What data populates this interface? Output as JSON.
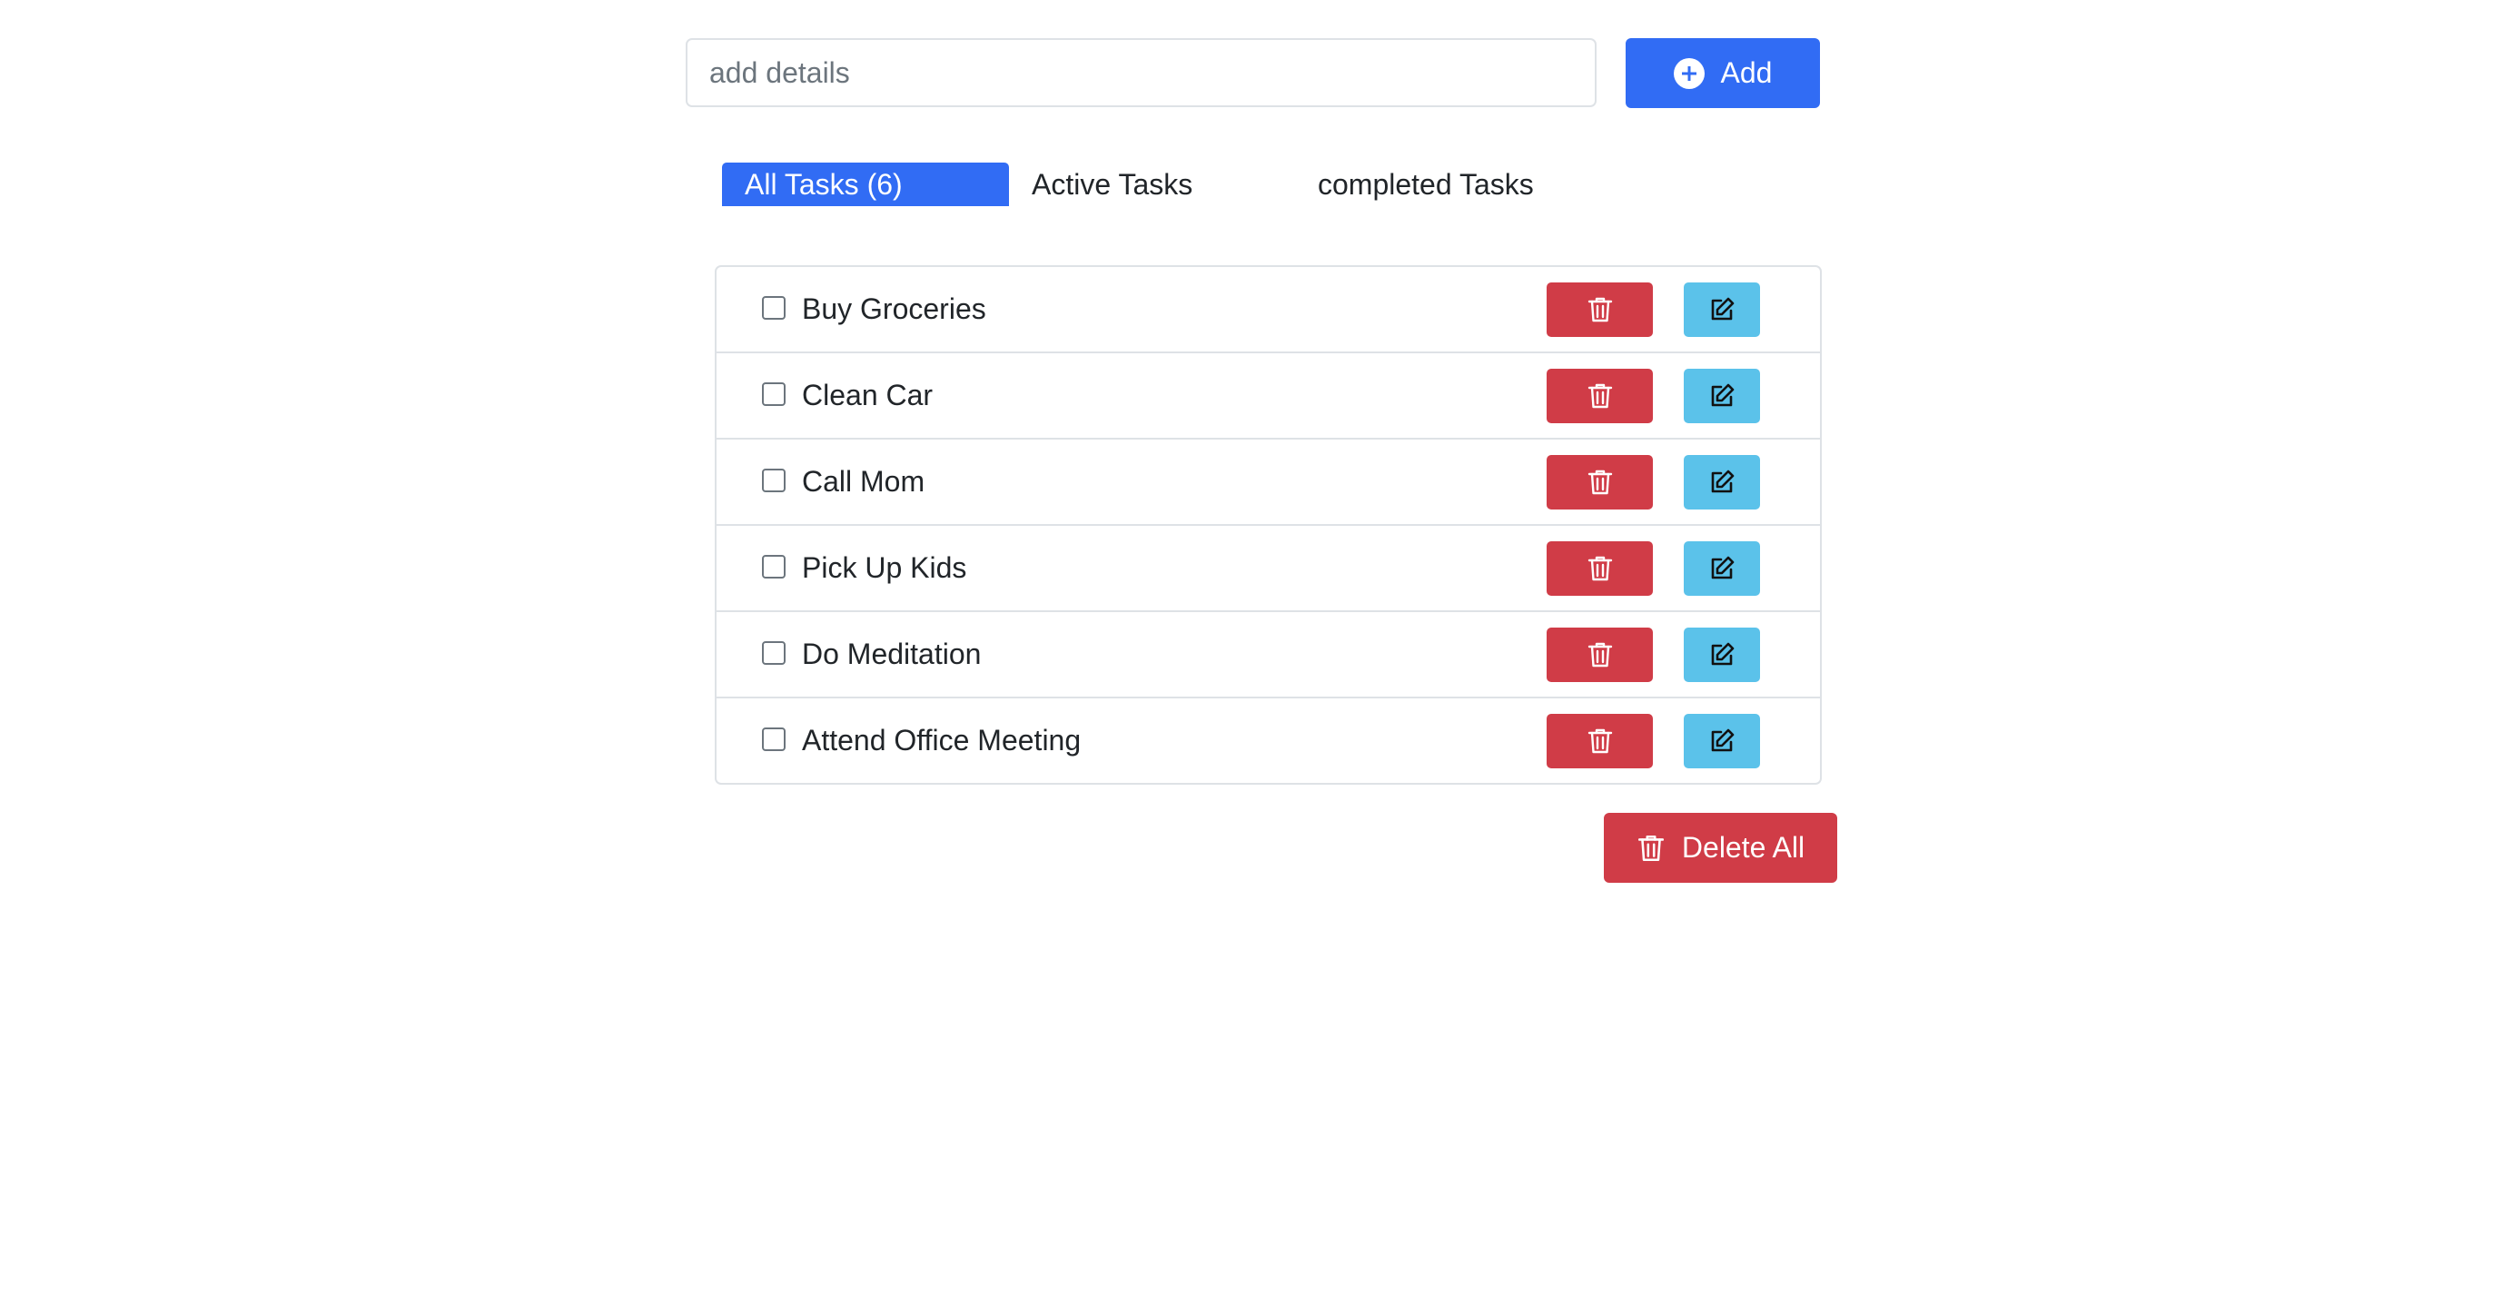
{
  "input": {
    "placeholder": "add details",
    "value": ""
  },
  "add_button": {
    "label": "Add",
    "icon": "plus-circle-icon",
    "color": "#316cf4"
  },
  "tabs": [
    {
      "label": "All Tasks (6)",
      "active": true
    },
    {
      "label": "Active Tasks",
      "active": false
    },
    {
      "label": "completed Tasks",
      "active": false
    }
  ],
  "tasks": [
    {
      "label": "Buy Groceries",
      "completed": false
    },
    {
      "label": "Clean Car",
      "completed": false
    },
    {
      "label": "Call Mom",
      "completed": false
    },
    {
      "label": "Pick Up Kids",
      "completed": false
    },
    {
      "label": "Do Meditation",
      "completed": false
    },
    {
      "label": "Attend Office Meeting",
      "completed": false
    }
  ],
  "task_actions": {
    "delete_icon": "trash-icon",
    "delete_color": "#d03c47",
    "edit_icon": "edit-icon",
    "edit_color": "#5bc2ea"
  },
  "delete_all_button": {
    "label": "Delete All",
    "icon": "trash-icon",
    "color": "#d03c47"
  }
}
